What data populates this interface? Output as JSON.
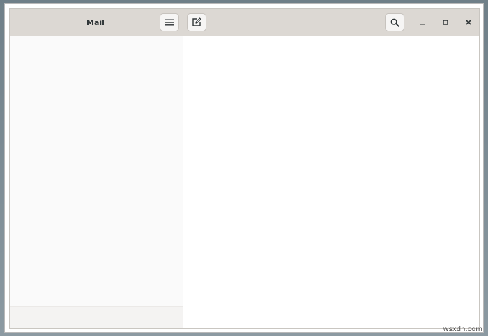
{
  "window": {
    "title": "Mail"
  },
  "headerbar": {
    "menu_icon": "hamburger-menu-icon",
    "compose_icon": "compose-edit-icon",
    "search_icon": "search-icon",
    "minimize_icon": "minimize-icon",
    "maximize_icon": "maximize-icon",
    "close_icon": "close-icon"
  },
  "watermark": {
    "text": "wsxdn.com"
  },
  "colors": {
    "headerbar": "#dcd8d3",
    "sidebar": "#fafafa",
    "content": "#ffffff",
    "text": "#2e3436"
  }
}
